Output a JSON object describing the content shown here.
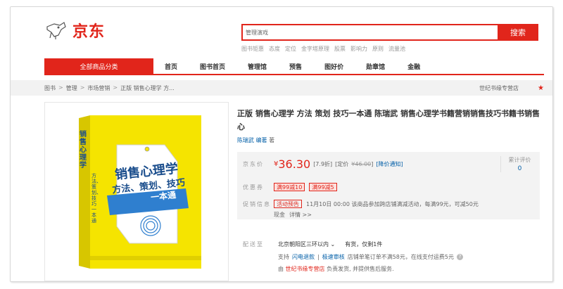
{
  "header": {
    "logo_text": "京东",
    "search_value": "管理演戏",
    "search_button": "搜索",
    "hotwords": [
      "图书钜惠",
      "态度",
      "定位",
      "金字塔原理",
      "股票",
      "影响力",
      "原则",
      "流量池"
    ]
  },
  "nav": {
    "all_categories": "全部商品分类",
    "items": [
      "首页",
      "图书首页",
      "管理馆",
      "预售",
      "图好价",
      "勋章馆",
      "金融"
    ]
  },
  "breadcrumb": {
    "items": [
      "图书",
      "管理",
      "市场营销",
      "正版 销售心理学 方..."
    ],
    "shop_name": "世纪书缘专营店"
  },
  "product": {
    "title": "正版 销售心理学 方法 策划 技巧一本通 陈瑞武 销售心理学书籍营销销售技巧书籍书销售心",
    "author": "陈瑞武",
    "author_role": "编著",
    "author_suffix": "著",
    "cover": {
      "title_line1": "销售心理学",
      "title_line2": "方法、策划、技巧",
      "title_line3": "一本通",
      "spine_title": "销售心理学",
      "spine_sub": "方法、策划、技巧一本通"
    }
  },
  "price": {
    "label": "京东价",
    "yen": "¥",
    "value": "36.30",
    "discount": "[7.9折]",
    "orig_label": "[定价",
    "orig_value": "¥46.00",
    "orig_close": "]",
    "notify": "[降价通知]",
    "rating_label": "累计评价",
    "rating_count": "0"
  },
  "coupons": {
    "label": "优惠券",
    "items": [
      "满99减10",
      "满99减5"
    ]
  },
  "promo": {
    "label": "促销信息",
    "tag": "活动预告",
    "text": "11月10日 00:00 该商品参加跨店铺满减活动，每满99元，可减50元",
    "extra_1": "现金",
    "extra_2": "详情 >>"
  },
  "delivery": {
    "label": "配送至",
    "area": "北京朝阳区三环以内 ⌄",
    "stock": "有货，仅剩1件",
    "service_prefix": "支持",
    "service_1": "闪电退款",
    "service_sep": "|",
    "service_2": "极速审核",
    "service_text": "店铺单笔订单不满58元，在线支付运费5元",
    "seller_prefix": "由",
    "seller_name": "世纪书缘专营店",
    "seller_text": "负责发货, 并提供售后服务."
  },
  "colors": {
    "brand_red": "#e1251b",
    "link_blue": "#005ea7",
    "cover_yellow": "#f5e400"
  }
}
